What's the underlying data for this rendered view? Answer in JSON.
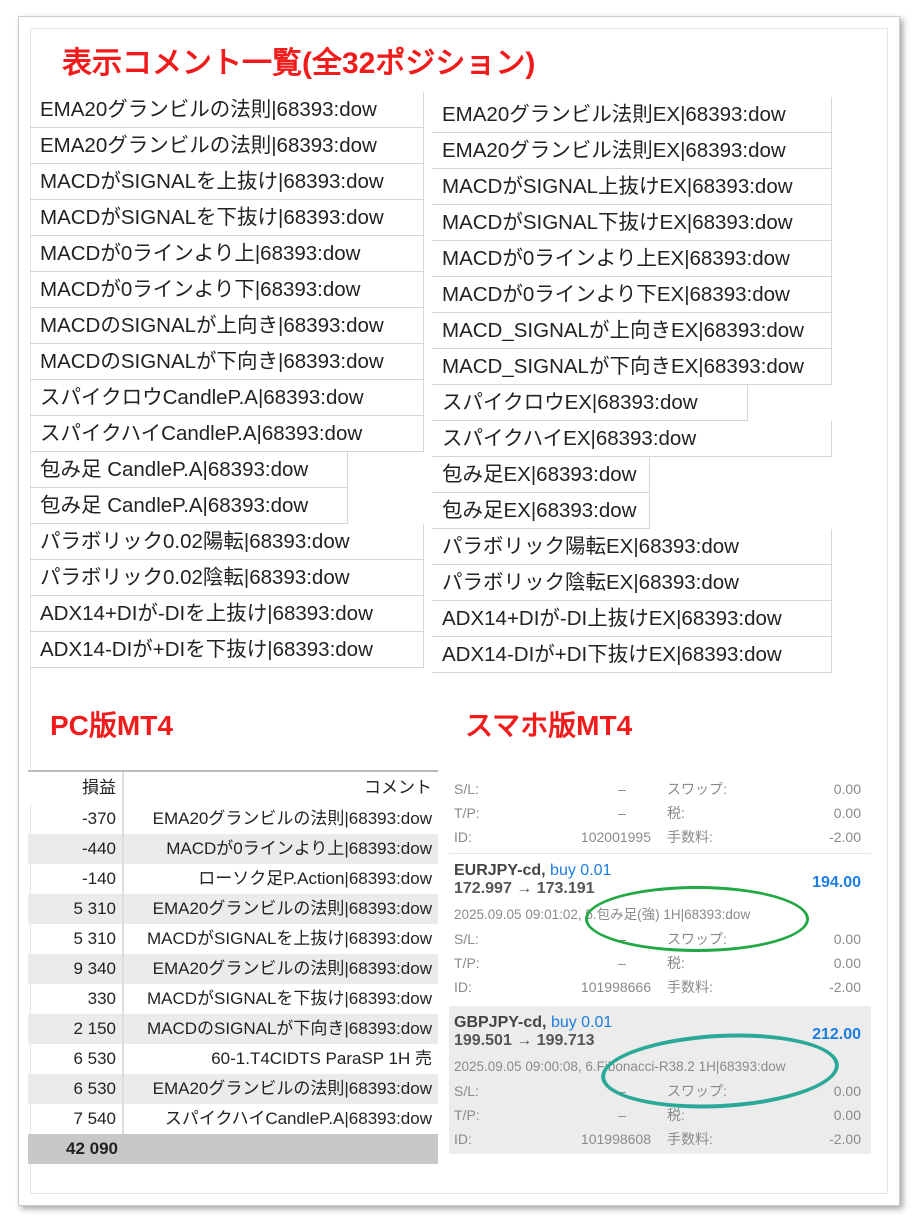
{
  "title": "表示コメント一覧(全32ポジション)",
  "left_list": [
    "EMA20グランビルの法則|68393:dow",
    "EMA20グランビルの法則|68393:dow",
    "MACDがSIGNALを上抜け|68393:dow",
    "MACDがSIGNALを下抜け|68393:dow",
    "MACDが0ラインより上|68393:dow",
    "MACDが0ラインより下|68393:dow",
    "MACDのSIGNALが上向き|68393:dow",
    "MACDのSIGNALが下向き|68393:dow",
    "スパイクロウCandleP.A|68393:dow",
    "スパイクハイCandleP.A|68393:dow",
    "包み足 CandleP.A|68393:dow",
    "包み足 CandleP.A|68393:dow",
    "パラボリック0.02陽転|68393:dow",
    "パラボリック0.02陰転|68393:dow",
    "ADX14+DIが-DIを上抜け|68393:dow",
    "ADX14-DIが+DIを下抜け|68393:dow"
  ],
  "right_list": [
    "EMA20グランビル法則EX|68393:dow",
    "EMA20グランビル法則EX|68393:dow",
    "MACDがSIGNAL上抜けEX|68393:dow",
    "MACDがSIGNAL下抜けEX|68393:dow",
    "MACDが0ラインより上EX|68393:dow",
    "MACDが0ラインより下EX|68393:dow",
    "MACD_SIGNALが上向きEX|68393:dow",
    "MACD_SIGNALが下向きEX|68393:dow",
    "スパイクロウEX|68393:dow",
    "スパイクハイEX|68393:dow",
    "包み足EX|68393:dow",
    "包み足EX|68393:dow",
    "パラボリック陽転EX|68393:dow",
    "パラボリック陰転EX|68393:dow",
    "ADX14+DIが-DI上抜けEX|68393:dow",
    "ADX14-DIが+DI下抜けEX|68393:dow"
  ],
  "pc_label": "PC版MT4",
  "sp_label": "スマホ版MT4",
  "pc_table": {
    "headers": [
      "損益",
      "コメント"
    ],
    "rows": [
      [
        "-370",
        "EMA20グランビルの法則|68393:dow"
      ],
      [
        "-440",
        "MACDが0ラインより上|68393:dow"
      ],
      [
        "-140",
        "ローソク足P.Action|68393:dow"
      ],
      [
        "5 310",
        "EMA20グランビルの法則|68393:dow"
      ],
      [
        "5 310",
        "MACDがSIGNALを上抜け|68393:dow"
      ],
      [
        "9 340",
        "EMA20グランビルの法則|68393:dow"
      ],
      [
        "330",
        "MACDがSIGNALを下抜け|68393:dow"
      ],
      [
        "2 150",
        "MACDのSIGNALが下向き|68393:dow"
      ],
      [
        "6 530",
        "60-1.T4CIDTS ParaSP 1H 売"
      ],
      [
        "6 530",
        "EMA20グランビルの法則|68393:dow"
      ],
      [
        "7 540",
        "スパイクハイCandleP.A|68393:dow"
      ]
    ],
    "total": "42 090"
  },
  "phone": {
    "labels": {
      "sl": "S/L:",
      "tp": "T/P:",
      "id": "ID:",
      "swap": "スワップ:",
      "tax": "税:",
      "fee": "手数料:",
      "dash": "–"
    },
    "top": {
      "swap": "0.00",
      "tax": "0.00",
      "id": "102001995",
      "fee": "-2.00"
    },
    "orders": [
      {
        "symbol": "EURJPY-cd,",
        "side": "buy 0.01",
        "prices": "172.997 → 173.191",
        "profit": "194.00",
        "comment": "2025.09.05 09:01:02, 5.包み足(強) 1H|68393:dow",
        "swap": "0.00",
        "tax": "0.00",
        "id": "101998666",
        "fee": "-2.00"
      },
      {
        "symbol": "GBPJPY-cd,",
        "side": "buy 0.01",
        "prices": "199.501 → 199.713",
        "profit": "212.00",
        "comment": "2025.09.05 09:00:08, 6.Fibonacci-R38.2 1H|68393:dow",
        "swap": "0.00",
        "tax": "0.00",
        "id": "101998608",
        "fee": "-2.00"
      }
    ]
  },
  "colors": {
    "accent_red": "#f21b1b",
    "profit_blue": "#1e7de0",
    "circle_green": "#22a844",
    "circle_teal": "#2aa898"
  }
}
